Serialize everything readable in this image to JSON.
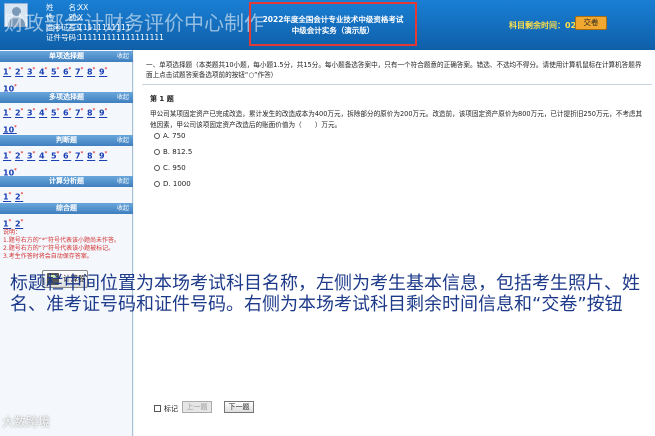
{
  "header": {
    "watermark": "财政部会计财务评价中心制作",
    "candidate": [
      {
        "label": "姓　　名：",
        "value": "XX"
      },
      {
        "label": "性　　别：",
        "value": "X"
      },
      {
        "label": "准考证号：",
        "value": "11111111111"
      },
      {
        "label": "证件号码：",
        "value": "111111111111111111"
      }
    ],
    "exam_line1": "2022年度全国会计专业技术中级资格考试",
    "exam_line2": "中级会计实务（演示版）",
    "timer_label": "科目剩余时间：",
    "timer_value": "02:27:40",
    "submit_label": "交卷"
  },
  "sidebar": {
    "sections": [
      {
        "title": "单项选择题",
        "collapse": "收起",
        "items": [
          "1",
          "2",
          "3",
          "4",
          "5",
          "6",
          "7",
          "8",
          "9",
          "10"
        ]
      },
      {
        "title": "多项选择题",
        "collapse": "收起",
        "items": [
          "1",
          "2",
          "3",
          "4",
          "5",
          "6",
          "7",
          "8",
          "9",
          "10"
        ]
      },
      {
        "title": "判断题",
        "collapse": "收起",
        "items": [
          "1",
          "2",
          "3",
          "4",
          "5",
          "6",
          "7",
          "8",
          "9",
          "10"
        ]
      },
      {
        "title": "计算分析题",
        "collapse": "收起",
        "items": [
          "1",
          "2"
        ]
      },
      {
        "title": "综合题",
        "collapse": "收起",
        "items": [
          "1",
          "2"
        ]
      }
    ],
    "notes": [
      "说明：",
      "1.题号右方的“*”符号代表该小题尚未作答。",
      "2.题号右方的“?”符号代表该小题被标记。",
      "3.考生作答时将会自动保存答案。"
    ],
    "calc_label": "计算器"
  },
  "main": {
    "instructions": "一、单项选择题（本类题共10小题，每小题1.5分，共15分。每小题备选答案中，只有一个符合题意的正确答案。错选、不选均不得分。请使用计算机鼠标在计算机答题界面上点击试题答案备选项前的按钮“○”作答）",
    "question_number": "第 1 题",
    "question_text": "甲公司某项固定资产已完成改造，累计发生的改造成本为400万元，拆除部分的原价为200万元。改造前，该项固定资产原价为800万元，已计提折旧250万元，不考虑其他因素，甲公司该项固定资产改造后的账面价值为（　　）万元。",
    "options": [
      {
        "letter": "A.",
        "text": "750"
      },
      {
        "letter": "B.",
        "text": "812.5"
      },
      {
        "letter": "C.",
        "text": "950"
      },
      {
        "letter": "D.",
        "text": "1000"
      }
    ],
    "mark_label": "标记",
    "prev_label": "上一题",
    "next_label": "下一题"
  },
  "subtitle": "标题栏中间位置为本场考试科目名称，左侧为考生基本信息，包括考生照片、姓名、准考证号码和证件号码。右侧为本场考试科目剩余时间信息和“交卷”按钮",
  "logo_text": "大数跨境",
  "colors": {
    "header_blue": "#1a7fd4",
    "highlight_red": "#e53935",
    "timer_yellow": "#ffe04a",
    "subtitle_blue": "#1d3a8a"
  }
}
